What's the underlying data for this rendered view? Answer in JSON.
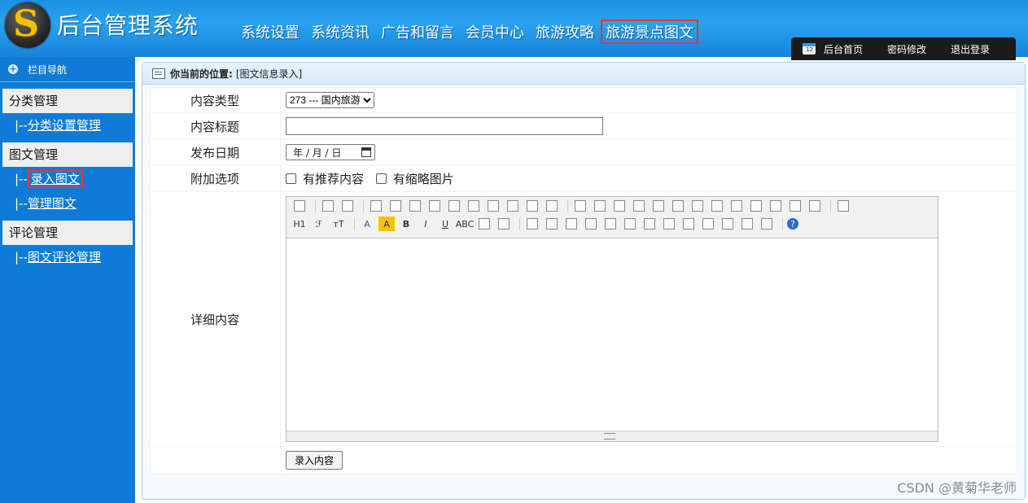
{
  "header": {
    "app_title": "后台管理系统",
    "nav": [
      {
        "label": "系统设置"
      },
      {
        "label": "系统资讯"
      },
      {
        "label": "广告和留言"
      },
      {
        "label": "会员中心"
      },
      {
        "label": "旅游攻略"
      },
      {
        "label": "旅游景点图文",
        "active": true
      }
    ],
    "right_tools": {
      "home": "后台首页",
      "password": "密码修改",
      "logout": "退出登录"
    }
  },
  "sidebar": {
    "title": "栏目导航",
    "groups": [
      {
        "label": "分类管理",
        "items": [
          {
            "prefix": "|--",
            "label": "分类设置管理"
          }
        ]
      },
      {
        "label": "图文管理",
        "items": [
          {
            "prefix": "|--",
            "label": "录入图文",
            "active": true
          },
          {
            "prefix": "|--",
            "label": "管理图文"
          }
        ]
      },
      {
        "label": "评论管理",
        "items": [
          {
            "prefix": "|--",
            "label": "图文评论管理"
          }
        ]
      }
    ]
  },
  "breadcrumb": {
    "label": "你当前的位置:",
    "value": "[图文信息录入]"
  },
  "form": {
    "content_type_label": "内容类型",
    "content_type_value": "273 --- 国内旅游",
    "title_label": "内容标题",
    "title_value": "",
    "date_label": "发布日期",
    "date_placeholder": "年 / 月 / 日",
    "options_label": "附加选项",
    "option_recommend": "有推荐内容",
    "option_thumbnail": "有缩略图片",
    "detail_label": "详细内容",
    "submit_label": "录入内容"
  },
  "editor": {
    "row1_icons": [
      "source",
      "sep",
      "undo",
      "redo",
      "sep",
      "preview",
      "print",
      "template",
      "word",
      "cut",
      "copy",
      "paste",
      "paste-text",
      "paste-word",
      "paste-html",
      "sep",
      "align-left",
      "align-center",
      "align-right",
      "justify",
      "ordered-list",
      "unordered-list",
      "indent",
      "outdent",
      "subscript",
      "superscript",
      "clear-format",
      "format-brush",
      "select-all",
      "sep",
      "fullscreen"
    ],
    "row2_icons": [
      "H1",
      "font",
      "size",
      "sep",
      "font-color",
      "highlight",
      "bold",
      "italic",
      "underline",
      "strikethrough",
      "line-height",
      "eraser",
      "sep",
      "image",
      "flash",
      "media",
      "table-insert",
      "attach",
      "table",
      "hr",
      "emoticon",
      "image-gallery",
      "pagebreak",
      "anchor",
      "link",
      "unlink",
      "sep",
      "help"
    ],
    "row2_text": {
      "H1": "H1",
      "font": "ℱ",
      "size": "ᴛT",
      "font-color": "A",
      "highlight": "A",
      "bold": "B",
      "italic": "I",
      "underline": "U",
      "strikethrough": "ABC",
      "help": "?"
    }
  },
  "watermark": "CSDN @黄菊华老师"
}
